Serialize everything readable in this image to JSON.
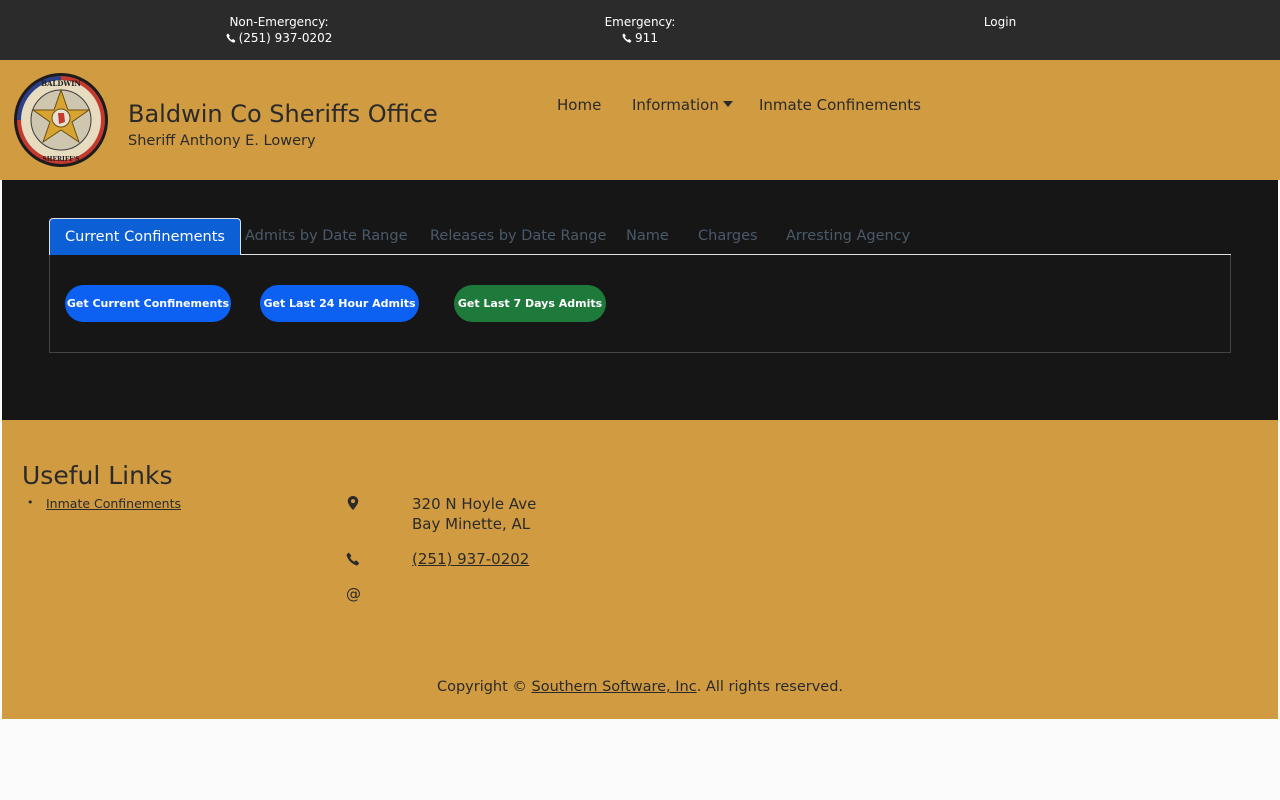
{
  "topbar": {
    "non_emergency_label": "Non-Emergency:",
    "non_emergency_phone": "(251) 937-0202",
    "emergency_label": "Emergency:",
    "emergency_phone": "911",
    "login_label": "Login"
  },
  "header": {
    "title": "Baldwin Co Sheriffs Office",
    "subtitle": "Sheriff Anthony E. Lowery",
    "seal_icon": "sheriff-badge-seal",
    "nav": {
      "home": "Home",
      "information": "Information",
      "inmate": "Inmate Confinements"
    }
  },
  "tabs": {
    "current": "Current Confinements",
    "admits": "Admits by Date Range",
    "releases": "Releases by Date Range",
    "name": "Name",
    "charges": "Charges",
    "agency": "Arresting Agency"
  },
  "buttons": {
    "current": "Get Current Confinements",
    "last24": "Get Last 24 Hour Admits",
    "last7": "Get Last 7 Days Admits"
  },
  "footer": {
    "useful_title": "Useful Links",
    "useful_links": [
      "Inmate Confinements"
    ],
    "address_line1": "320 N Hoyle Ave",
    "address_line2": "Bay Minette, AL",
    "phone": "(251) 937-0202",
    "email_symbol": "@",
    "copyright_prefix": "Copyright © ",
    "copyright_link": "Southern Software, Inc",
    "copyright_suffix": ". All rights reserved."
  },
  "colors": {
    "topbar_bg": "#2b2b2b",
    "header_bg": "#d19b42",
    "main_bg": "#161616",
    "active_tab": "#0d5fd6",
    "primary_button": "#0d61f2",
    "success_button": "#1e7a3a"
  }
}
